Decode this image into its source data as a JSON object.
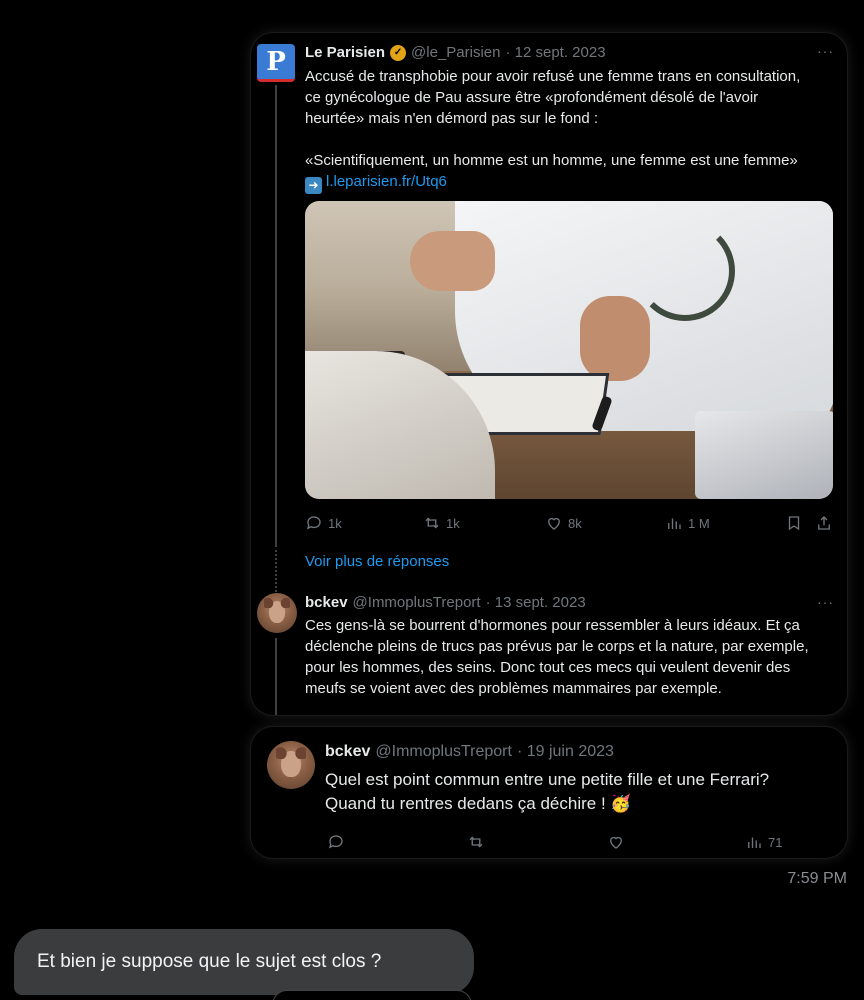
{
  "tweet1": {
    "name": "Le Parisien",
    "handle": "@le_Parisien",
    "date": "· 12 sept. 2023",
    "more": "···",
    "avatar_letter": "P",
    "line1": "Accusé de transphobie pour avoir refusé une femme trans en consultation,",
    "line2": "ce gynécologue de Pau assure être «profondément désolé de l'avoir",
    "line3": "heurtée» mais n'en démord pas sur le fond :",
    "line4": "«Scientifiquement, un homme est un homme, une femme est une femme»",
    "link": "l.leparisien.fr/Utq6",
    "replies": "1k",
    "retweets": "1k",
    "likes": "8k",
    "views": "1 M"
  },
  "see_more": "Voir plus de réponses",
  "reply": {
    "name": "bckev",
    "handle": "@ImmoplusTreport",
    "date": "· 13 sept. 2023",
    "more": "···",
    "line1": "Ces gens-là se bourrent d'hormones pour ressembler à leurs idéaux. Et ça",
    "line2": "déclenche pleins de trucs pas prévus par le corps et la nature, par exemple,",
    "line3": "pour les hommes, des seins. Donc tout ces mecs qui veulent devenir des",
    "line4": "meufs se voient avec des problèmes mammaires par exemple."
  },
  "tweet2": {
    "name": "bckev",
    "handle": "@ImmoplusTreport",
    "date": "· 19 juin 2023",
    "line1": "Quel est point commun entre une petite fille et une Ferrari?",
    "line2": "Quand tu rentres dedans ça déchire !",
    "emoji": "🥳",
    "views": "71"
  },
  "timestamp": "7:59 PM",
  "message": "Et bien je suppose que le sujet est clos ?"
}
